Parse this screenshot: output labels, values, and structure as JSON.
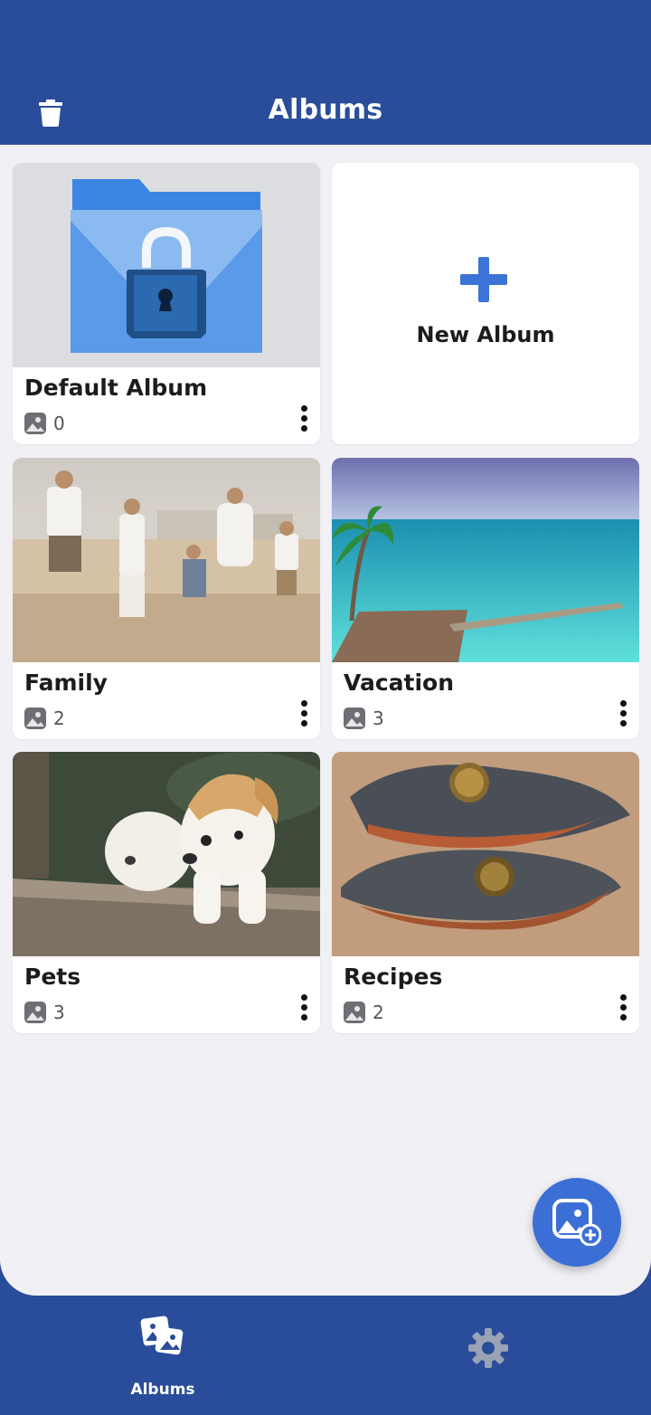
{
  "header": {
    "title": "Albums",
    "delete_icon": "trash-icon"
  },
  "albums": [
    {
      "name": "Default Album",
      "count": "0",
      "locked": true
    },
    {
      "name": "Family",
      "count": "2"
    },
    {
      "name": "Vacation",
      "count": "3"
    },
    {
      "name": "Pets",
      "count": "3"
    },
    {
      "name": "Recipes",
      "count": "2"
    }
  ],
  "new_album": {
    "label": "New Album",
    "icon": "plus-icon"
  },
  "fab": {
    "icon": "add-photo-icon"
  },
  "bottom_nav": [
    {
      "label": "Albums",
      "icon": "albums-icon",
      "active": true
    },
    {
      "label": "",
      "icon": "gear-icon",
      "active": false
    }
  ],
  "colors": {
    "primary": "#2a4d9b",
    "accent": "#3c6fd6",
    "background": "#f1f0f5"
  }
}
